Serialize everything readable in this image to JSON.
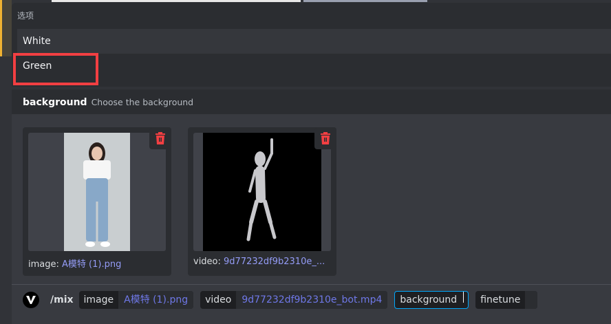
{
  "popup": {
    "title": "选项",
    "options": [
      {
        "label": "White"
      },
      {
        "label": "Green"
      }
    ]
  },
  "option_header": {
    "name": "background",
    "description": "Choose the background"
  },
  "attachments": [
    {
      "label": "image:",
      "value": "A模特 (1).png",
      "kind": "image"
    },
    {
      "label": "video:",
      "value": "9d77232df9b2310e_...",
      "kind": "video"
    }
  ],
  "command": {
    "name": "/mix",
    "params": [
      {
        "key": "image",
        "value": "A模特 (1).png"
      },
      {
        "key": "video",
        "value": "9d77232df9b2310e_bot.mp4"
      },
      {
        "key": "background",
        "value": ""
      },
      {
        "key": "finetune",
        "value": ""
      }
    ]
  },
  "colors": {
    "highlight": "#f23f42",
    "accent": "#00a8fc",
    "link": "#949cf7",
    "delete": "#f23f42"
  }
}
